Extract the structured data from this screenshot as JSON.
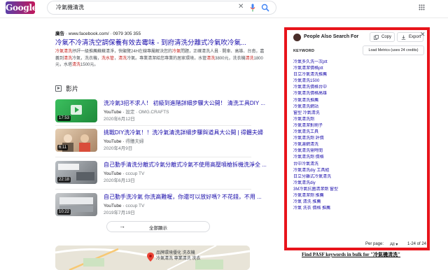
{
  "app": {
    "logo_text": "Google",
    "search_query": "冷氣機清洗"
  },
  "ad": {
    "meta_label": "廣告",
    "meta_site": "www.facebook.com/",
    "meta_phone": "0979 305 355",
    "title": "冷氣不冷清洗空調保養有效去霉味 - 到府清洗分離式冷氣吹冷氣...",
    "desc_parts": [
      "冷氣清洗",
      "抒評一級推薦蘇蘇清淨，快顯覽24H在線專屬解決您的",
      "冷氣",
      "問題，正確清洗人員 · 開車、高雄、台南，嘉義到",
      "清洗",
      "冷氣，洗衣機，",
      "洗水管",
      "，",
      "清洗",
      "冷氣。專業清潔給您專業的居家環境，水管",
      "清洗",
      "3800元，洗衣機",
      "清洗",
      "1800元，水塔",
      "清洗",
      "1500元。"
    ]
  },
  "videos": {
    "heading": "影片",
    "items": [
      {
        "title": "洗冷氣3招不求人！ 初級到進階詳細步驟大公開！ 清洗工具DIY ...",
        "source": "YouTube",
        "channel": "設定 · OMG.CRAFTS",
        "date": "2020年6月12日",
        "duration": "17:53",
        "thumb_color": "#2fa84f"
      },
      {
        "title": "挑戰DIY洗冷氣！！洗冷氣清洗詳細步驟與道具大公開 | 得體夫婦",
        "source": "YouTube",
        "channel": "得體夫婦",
        "date": "2020年4月9日",
        "duration": "6:11",
        "thumb_color": "#c8a98a"
      },
      {
        "title": "自己動手清洗分離式冷氣分離式冷氣不使用高壓噴槍拆機洗淨全 ...",
        "source": "YouTube",
        "channel": "cccup TV",
        "date": "2020年6月13日",
        "duration": "22:18",
        "thumb_color": "#8a8f94"
      },
      {
        "title": "自己動手洗冷氣 你洗高難喔，你還可以放好嗎? 不花錢，不用 ...",
        "source": "YouTube",
        "channel": "cccup TV",
        "date": "2019年7月19日",
        "duration": "10:22",
        "thumb_color": "#9a9ea3"
      }
    ],
    "show_all_label": "全部顯示"
  },
  "map": {
    "label_line1": "品牌環境優化 洗衣機",
    "label_line2": "冷氣清洗 專業清洗 洗衣"
  },
  "panel": {
    "title": "People Also Search For",
    "copy_label": "Copy",
    "export_label": "Export",
    "keyword_header": "KEYWORD",
    "load_metrics_label": "Load Metrics (uses 24 credits)",
    "keywords": [
      "冷氣多久洗一次ptt",
      "冷氣清潔價格ptt",
      "日立冷氣清洗推薦",
      "冷氣清洗1500",
      "冷氣清洗價格台中",
      "冷氣清洗價格高雄",
      "冷氣清洗推薦",
      "冷氣清洗網站",
      "窗型 冷氣清洗",
      "冷氣清洗劑",
      "冷氣清潔對刷子",
      "冷氣清洗工具",
      "冷氣清洗劑 評價",
      "冷氣濾網清洗",
      "冷氣清洗需時間",
      "冷氣清洗劑 價格",
      "台中冷氣清洗",
      "冷氣清洗diy 工具組",
      "日立分離式冷氣清洗",
      "冷氣清洗diy",
      "3M冷氣抗菌清潔劑 窗型",
      "冷氣清潔劑 推薦",
      "冷氣 清洗 推薦",
      "冷氣 洗衣 價格 推薦"
    ],
    "per_page_label": "Per page:",
    "per_page_value": "All",
    "range_label": "1-24 of 24"
  },
  "caption": "Find PASF keywords in bulk for \"冷氣機清洗\""
}
